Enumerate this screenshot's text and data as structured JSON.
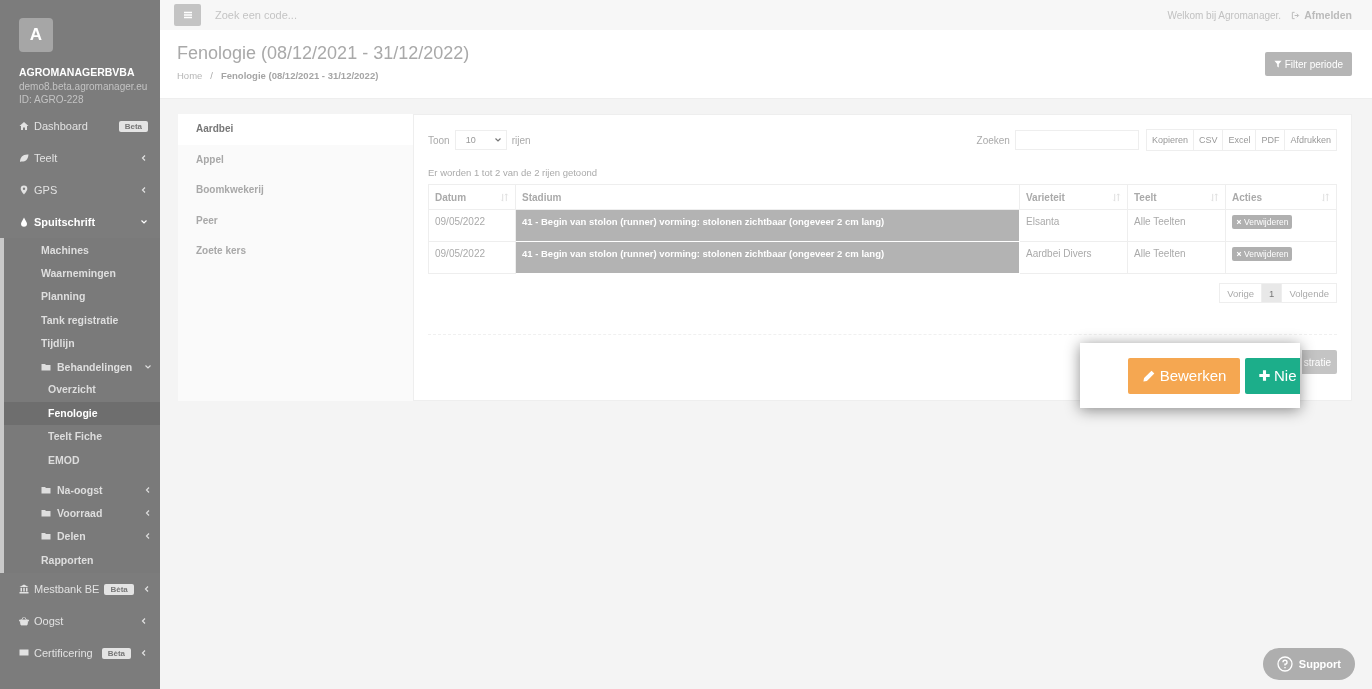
{
  "sidebar": {
    "brand": {
      "initial": "A",
      "name": "AGROMANAGERBVBA",
      "domain": "demo8.beta.agromanager.eu",
      "id": "ID: AGRO-228"
    },
    "items": [
      {
        "label": "Dashboard",
        "badge": "Beta"
      },
      {
        "label": "Teelt",
        "expanded": false
      },
      {
        "label": "GPS",
        "expanded": false
      },
      {
        "label": "Spuitschrift",
        "expanded": true,
        "children": [
          {
            "label": "Machines",
            "selected": false
          },
          {
            "label": "Waarnemingen",
            "selected": false
          },
          {
            "label": "Planning",
            "selected": false
          },
          {
            "label": "Tank registratie",
            "selected": false
          },
          {
            "label": "Tijdlijn",
            "selected": false
          },
          {
            "label": "Behandelingen",
            "kind": "folder",
            "expanded": true,
            "selected": false,
            "children": [
              {
                "label": "Overzicht",
                "selected": false
              },
              {
                "label": "Fenologie",
                "selected": true
              },
              {
                "label": "Teelt Fiche",
                "selected": false
              },
              {
                "label": "EMOD",
                "selected": false
              }
            ]
          },
          {
            "label": "Na-oogst",
            "kind": "folder",
            "expanded": false,
            "selected": false
          },
          {
            "label": "Voorraad",
            "kind": "folder",
            "expanded": false,
            "selected": false
          },
          {
            "label": "Delen",
            "kind": "folder",
            "expanded": false,
            "selected": false
          },
          {
            "label": "Rapporten",
            "selected": false
          }
        ]
      },
      {
        "label": "Mestbank BE",
        "badge": "Bèta",
        "expanded": false
      },
      {
        "label": "Oogst",
        "expanded": false
      },
      {
        "label": "Certificering",
        "badge": "Bèta",
        "expanded": false
      }
    ]
  },
  "topbar": {
    "search_placeholder": "Zoek een code...",
    "welcome": "Welkom bij Agromanager.",
    "logout": "Afmelden"
  },
  "header": {
    "title": "Fenologie (08/12/2021 - 31/12/2022)",
    "breadcrumb_separator": "/",
    "breadcrumb": [
      "Home",
      "Fenologie (08/12/2021 - 31/12/2022)"
    ],
    "filter_button": "Filter periode"
  },
  "tabs": [
    {
      "label": "Aardbei",
      "selected": true
    },
    {
      "label": "Appel",
      "selected": false
    },
    {
      "label": "Boomkwekerij",
      "selected": false
    },
    {
      "label": "Peer",
      "selected": false
    },
    {
      "label": "Zoete kers",
      "selected": false
    }
  ],
  "table": {
    "show_label": "Toon",
    "page_size": "10",
    "rows_label": "rijen",
    "search_label": "Zoeken",
    "exports": [
      "Kopieren",
      "CSV",
      "Excel",
      "PDF",
      "Afdrukken"
    ],
    "info": "Er worden 1 tot 2 van de 2 rijen getoond",
    "columns": [
      "Datum",
      "Stadium",
      "Varieteit",
      "Teelt",
      "Acties"
    ],
    "rows": [
      {
        "datum": "09/05/2022",
        "stadium": "41 - Begin van stolon (runner) vorming: stolonen zichtbaar (ongeveer 2 cm lang)",
        "varieteit": "Elsanta",
        "teelt": "Alle Teelten",
        "action": "Verwijderen"
      },
      {
        "datum": "09/05/2022",
        "stadium": "41 - Begin van stolon (runner) vorming: stolonen zichtbaar (ongeveer 2 cm lang)",
        "varieteit": "Aardbei Divers",
        "teelt": "Alle Teelten",
        "action": "Verwijderen"
      }
    ],
    "pagination": [
      {
        "label": "Vorige",
        "selected": false
      },
      {
        "label": "1",
        "selected": true
      },
      {
        "label": "Volgende",
        "selected": false
      }
    ],
    "footer_button": "stratie"
  },
  "popup": {
    "edit_button": "Bewerken",
    "new_button": "Nie"
  },
  "support": "Support"
}
